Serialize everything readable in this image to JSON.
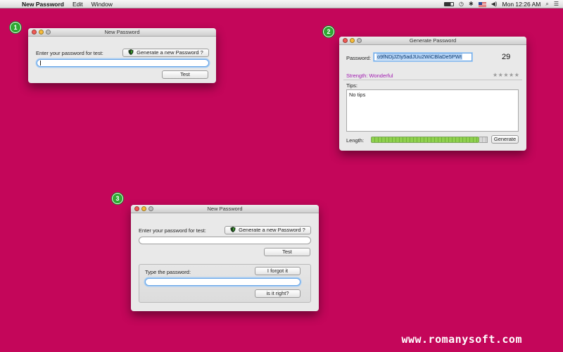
{
  "menubar": {
    "app_name": "New Password",
    "menus": [
      "Edit",
      "Window"
    ],
    "clock": "Mon 12:26 AM"
  },
  "badges": [
    "1",
    "2",
    "3"
  ],
  "window1": {
    "title": "New Password",
    "prompt": "Enter your password for test:",
    "generate_label": "Generate a new Password ?",
    "test_label": "Test"
  },
  "window2": {
    "title": "Generate Password",
    "password_label": "Password:",
    "password_value": "o9fNDjJZty5adJUu2WiCBlaDe5PWt",
    "length_count": "29",
    "strength_text": "Strength: Wonderful",
    "stars": "★★★★★",
    "tips_label": "Tips:",
    "tips_text": "No tips",
    "length_label": "Length:",
    "generate_label": "Generate",
    "length_fraction": 0.93
  },
  "window3": {
    "title": "New Password",
    "prompt": "Enter your password for test:",
    "generate_label": "Generate a new Password ?",
    "test_label": "Test",
    "type_label": "Type the password:",
    "forgot_label": "I forgot it",
    "check_label": "is it right?"
  },
  "watermark": "www.romanysoft.com",
  "colors": {
    "desktop": "#c4065a",
    "badge": "#2ea832",
    "strength": "#a01ab0",
    "focus": "#6aa6e6"
  }
}
